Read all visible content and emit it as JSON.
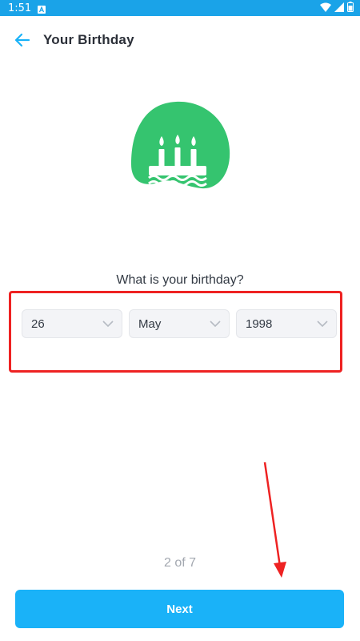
{
  "status_bar": {
    "time": "1:51",
    "notification_icon": "a-notification-icon",
    "wifi_icon": "wifi-icon",
    "signal_icon": "signal-icon",
    "battery_icon": "battery-icon"
  },
  "header": {
    "title": "Your Birthday",
    "back_icon": "arrow-left-icon"
  },
  "illustration": {
    "icon": "birthday-cake-icon",
    "color": "#35c46f"
  },
  "form": {
    "question": "What is your birthday?",
    "day": {
      "value": "26"
    },
    "month": {
      "value": "May"
    },
    "year": {
      "value": "1998"
    }
  },
  "footer": {
    "step": "2 of 7",
    "next_label": "Next"
  },
  "colors": {
    "accent": "#1ab2f8",
    "status_bar": "#1aa3e8",
    "annotation": "#ee2222"
  }
}
